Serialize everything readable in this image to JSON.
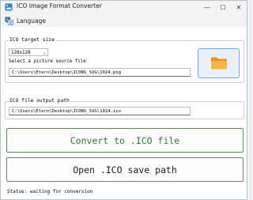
{
  "window": {
    "title": "ICO Image Format Converter",
    "controls": {
      "minimize": "—",
      "maximize": "☐",
      "close": "✕"
    }
  },
  "menu": {
    "language_label": "Language"
  },
  "target_group": {
    "title": " ICO target size",
    "size_selected": "128x128",
    "source_label": "Select a picture source file",
    "source_path": "C:\\Users\\Etern\\Desktop\\ICONS_SVG\\1024.png"
  },
  "output_group": {
    "title": " ICO file output path",
    "output_path": "C:\\Users\\Etern\\Desktop\\ICONS_SVG\\1024.ico"
  },
  "buttons": {
    "convert": "Convert to .ICO file",
    "open": "Open .ICO save path"
  },
  "status": "Status: waiting for conversion",
  "icons": {
    "app": "app-image-icon",
    "language": "language-icon",
    "folder": "folder-icon"
  },
  "colors": {
    "folder_fill": "#f5a623",
    "folder_button_bg": "#e8f1fb",
    "convert_text": "#2a7a2a"
  }
}
